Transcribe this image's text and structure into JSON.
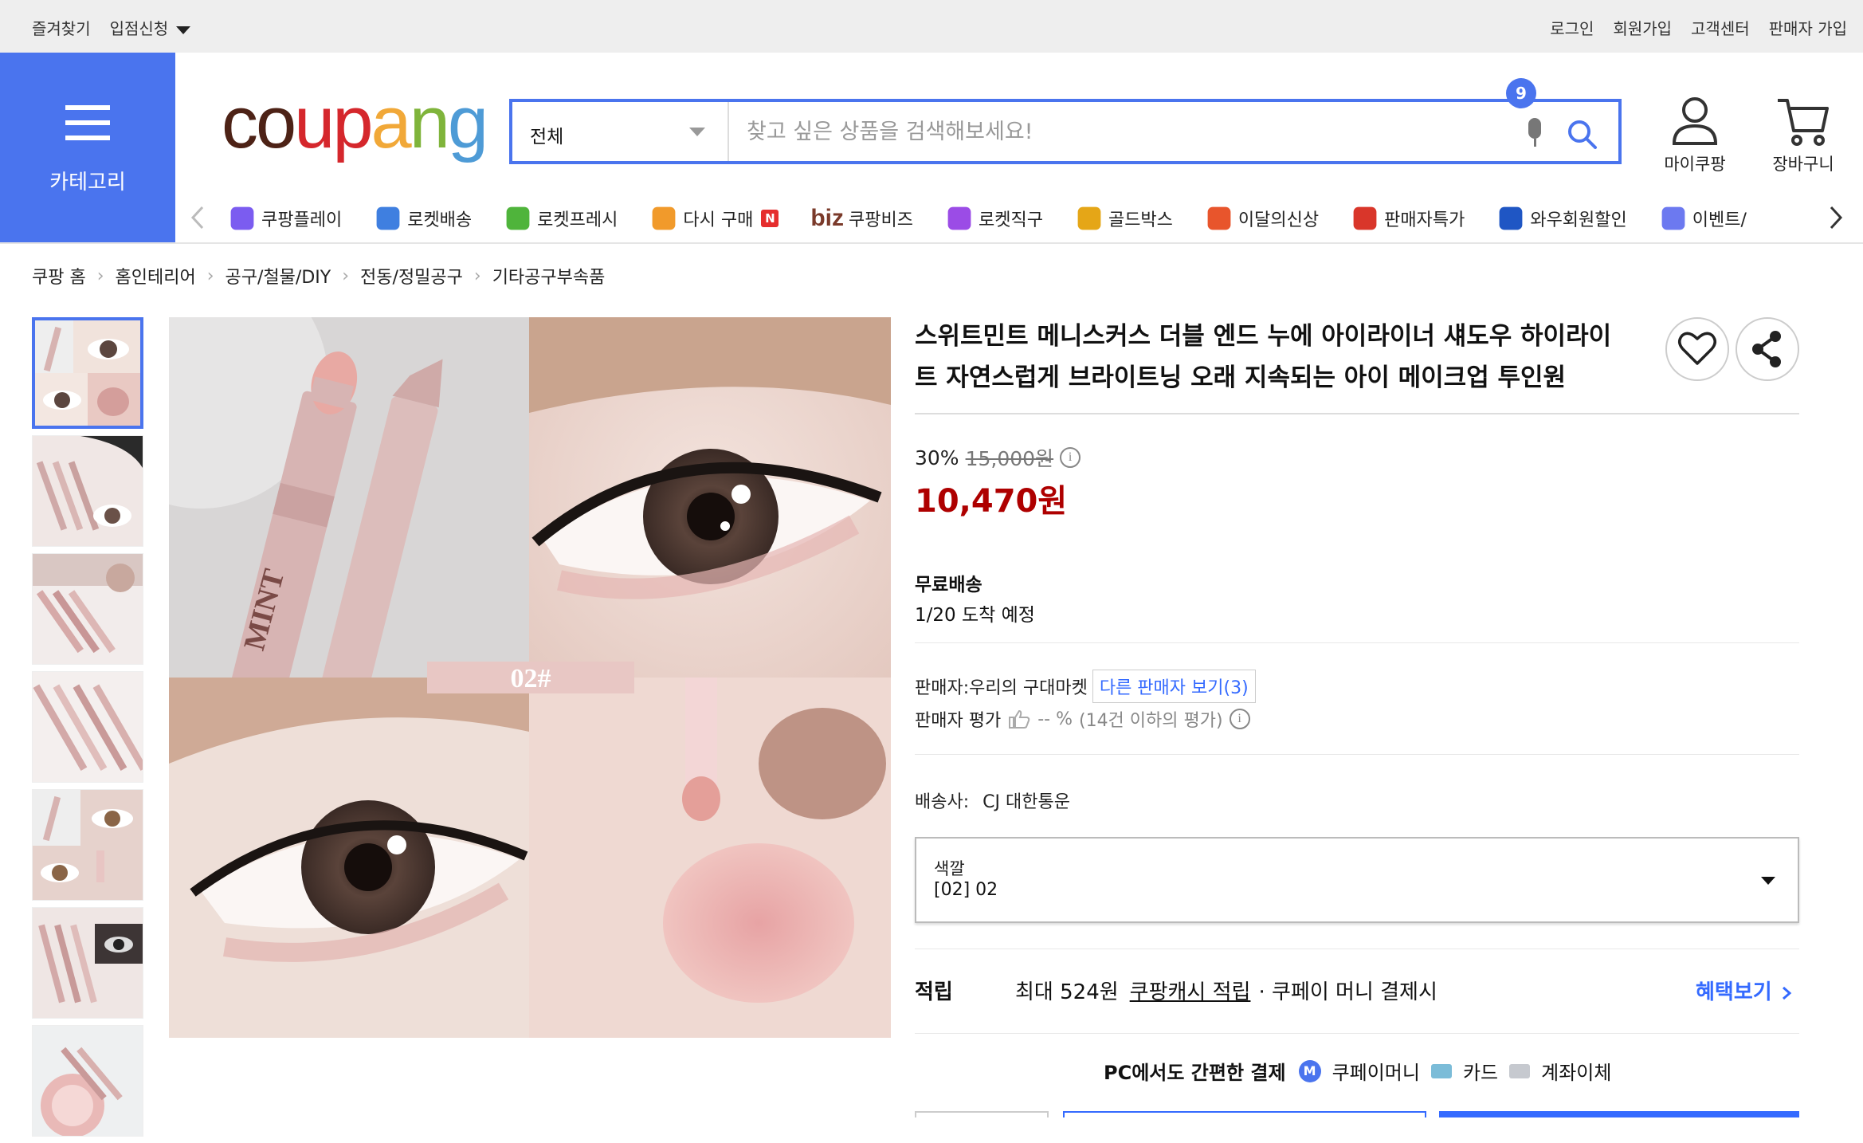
{
  "topbar": {
    "bookmark": "즐겨찾기",
    "store_apply": "입점신청",
    "login": "로그인",
    "signup": "회원가입",
    "customer_center": "고객센터",
    "seller_signup": "판매자 가입"
  },
  "header": {
    "category_label": "카테고리",
    "logo": {
      "c1": "c",
      "o": "o",
      "u": "u",
      "p": "p",
      "a": "a",
      "n": "n",
      "g": "g"
    },
    "search": {
      "category_value": "전체",
      "placeholder": "찾고 싶은 상품을 검색해보세요!"
    },
    "mycoupang_label": "마이쿠팡",
    "cart_label": "장바구니",
    "cart_count": "9"
  },
  "nav": {
    "items": [
      {
        "label": "쿠팡플레이",
        "icon": "coupang-play-icon"
      },
      {
        "label": "로켓배송",
        "icon": "rocket-delivery-icon"
      },
      {
        "label": "로켓프레시",
        "icon": "rocket-fresh-icon"
      },
      {
        "label": "다시 구매",
        "icon": "rebuy-basket-icon",
        "badge": "N"
      },
      {
        "label": "쿠팡비즈",
        "icon": "biz-icon",
        "prefix": "biz"
      },
      {
        "label": "로켓직구",
        "icon": "rocket-global-icon"
      },
      {
        "label": "골드박스",
        "icon": "goldbox-icon"
      },
      {
        "label": "이달의신상",
        "icon": "new-bag-icon"
      },
      {
        "label": "판매자특가",
        "icon": "seller-deal-icon"
      },
      {
        "label": "와우회원할인",
        "icon": "wow-icon"
      },
      {
        "label": "이벤트/",
        "icon": "event-coupon-icon"
      }
    ]
  },
  "breadcrumb": [
    "쿠팡 홈",
    "홈인테리어",
    "공구/철물/DIY",
    "전동/정밀공구",
    "기타공구부속품"
  ],
  "product": {
    "title": "스위트민트 메니스커스 더블 엔드 누에 아이라이너 섀도우 하이라이트 자연스럽게 브라이트닝 오래 지속되는 아이 메이크업 투인원",
    "discount_rate": "30%",
    "original_price": "15,000원",
    "price": "10,470원",
    "shipping_label": "무료배송",
    "arrival": "1/20 도착 예정",
    "seller_prefix": "판매자:",
    "seller_name": "우리의 구대마켓",
    "other_sellers": "다른 판매자 보기(3)",
    "seller_rating_label": "판매자 평가",
    "seller_rating_value": "-- %",
    "seller_rating_note": "(14건 이하의 평가)",
    "courier_label": "배송사:",
    "courier_name": "CJ 대한통운",
    "option_label": "색깔",
    "option_value": "[02] 02",
    "image_label": "02#",
    "image_brand": "MINT",
    "reward_label": "적립",
    "reward_max": "최대 524원",
    "reward_link": "쿠팡캐시 적립",
    "reward_cond": "· 쿠페이 머니 결제시",
    "benefit_link": "혜택보기",
    "pc_pay_label": "PC에서도 간편한 결제",
    "pay_money": "쿠페이머니",
    "pay_money_badge": "M",
    "pay_card": "카드",
    "pay_bank": "계좌이체"
  },
  "colors": {
    "accent": "#4a74ee",
    "price_red": "#ae0000",
    "link_blue": "#346aff"
  }
}
